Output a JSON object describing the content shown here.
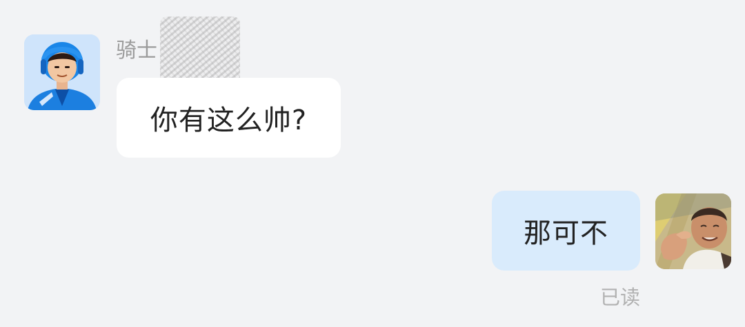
{
  "chat": {
    "incoming": {
      "sender_name": "骑士",
      "message": "你有这么帅?"
    },
    "outgoing": {
      "message": "那可不",
      "status": "已读"
    }
  },
  "colors": {
    "background": "#f2f3f5",
    "incoming_bubble": "#ffffff",
    "outgoing_bubble": "#d9ebfc",
    "muted_text": "#9b9b9b"
  },
  "icons": {
    "rider_avatar": "delivery-rider-helmet-icon",
    "user_avatar": "user-photo-avatar"
  }
}
